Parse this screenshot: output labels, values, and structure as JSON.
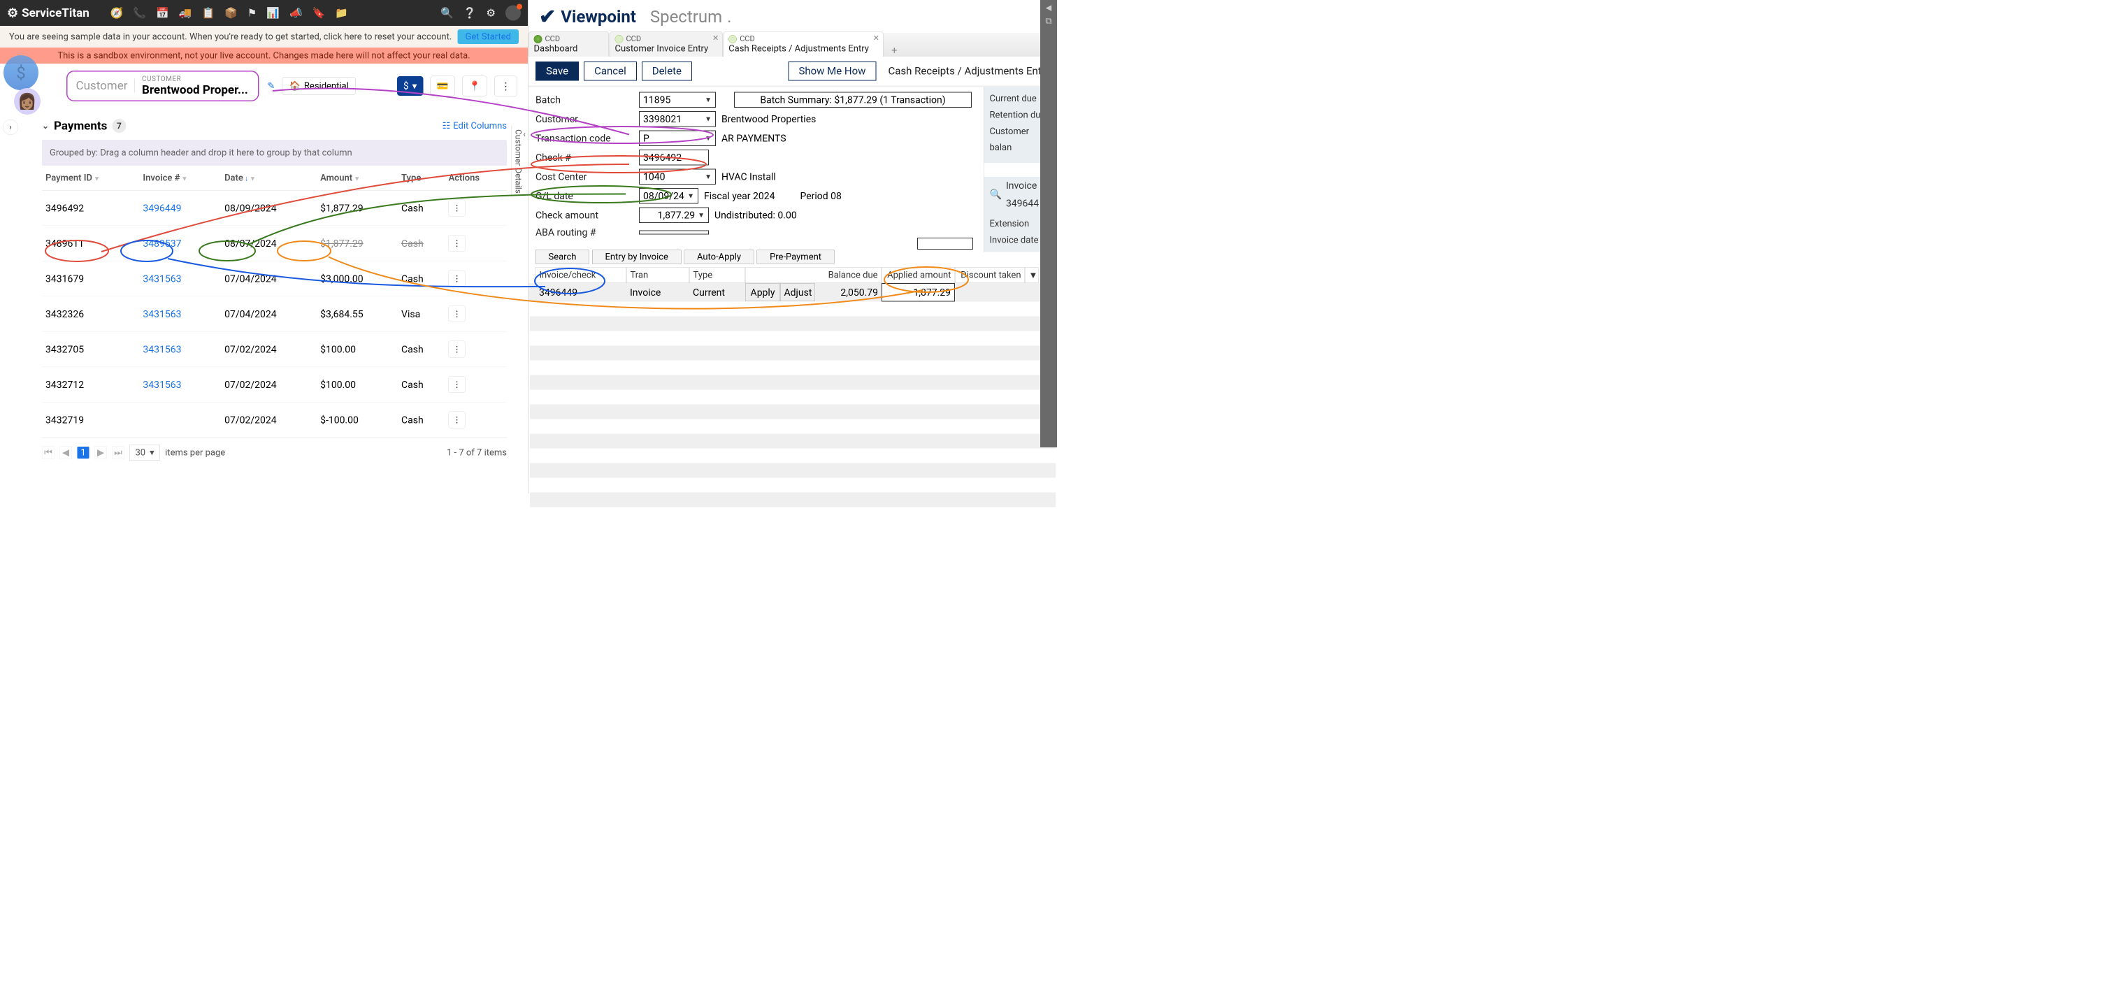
{
  "left": {
    "brand": "ServiceTitan",
    "banner1": "You are seeing sample data in your account. When you're ready to get started, click here to reset your account.",
    "get_started": "Get Started",
    "banner2": "This is a sandbox environment, not your live account. Changes made here will not affect your real data.",
    "customer_label_side": "Customer",
    "customer_smalllabel": "CUSTOMER",
    "customer_name": "Brentwood Proper...",
    "residential": "Residential",
    "side_tab": "Customer Details",
    "payments": {
      "title": "Payments",
      "count": "7",
      "edit_columns": "Edit Columns",
      "group_hint": "Grouped by:   Drag a column header and drop it here to group by that column",
      "cols": {
        "payment_id": "Payment ID",
        "invoice": "Invoice #",
        "date": "Date",
        "amount": "Amount",
        "type": "Type",
        "actions": "Actions"
      },
      "rows": [
        {
          "payment_id": "3496492",
          "invoice": "3496449",
          "date": "08/09/2024",
          "amount": "$1,877.29",
          "type": "Cash"
        },
        {
          "payment_id": "3489611",
          "invoice": "3489537",
          "date": "08/07/2024",
          "amount": "$1,877.29",
          "type": "Cash"
        },
        {
          "payment_id": "3431679",
          "invoice": "3431563",
          "date": "07/04/2024",
          "amount": "$3,000.00",
          "type": "Cash"
        },
        {
          "payment_id": "3432326",
          "invoice": "3431563",
          "date": "07/04/2024",
          "amount": "$3,684.55",
          "type": "Visa"
        },
        {
          "payment_id": "3432705",
          "invoice": "3431563",
          "date": "07/02/2024",
          "amount": "$100.00",
          "type": "Cash"
        },
        {
          "payment_id": "3432712",
          "invoice": "3431563",
          "date": "07/02/2024",
          "amount": "$100.00",
          "type": "Cash"
        },
        {
          "payment_id": "3432719",
          "invoice": "",
          "date": "07/02/2024",
          "amount": "$-100.00",
          "type": "Cash"
        }
      ],
      "pager": {
        "page": "1",
        "per_page": "30",
        "per_page_label": "items per page",
        "summary": "1 - 7 of 7 items"
      }
    }
  },
  "right": {
    "brand_vp": "Viewpoint",
    "brand_sp": "Spectrum",
    "tabs": [
      {
        "small": "CCD",
        "big": "Dashboard",
        "close": false,
        "dot": "green"
      },
      {
        "small": "CCD",
        "big": "Customer Invoice Entry",
        "close": true,
        "dot": "doc"
      },
      {
        "small": "CCD",
        "big": "Cash Receipts / Adjustments Entry",
        "close": true,
        "dot": "doc",
        "active": true
      }
    ],
    "save": "Save",
    "cancel": "Cancel",
    "delete": "Delete",
    "show_me": "Show Me How",
    "page_title": "Cash Receipts / Adjustments Entry",
    "form": {
      "batch_label": "Batch",
      "batch": "11895",
      "batch_summary": "Batch Summary: $1,877.29 (1 Transaction)",
      "customer_label": "Customer",
      "customer": "3398021",
      "customer_name": "Brentwood Properties",
      "tcode_label": "Transaction code",
      "tcode": "P",
      "tcode_name": "AR PAYMENTS",
      "check_label": "Check #",
      "check": "3496492",
      "cc_label": "Cost Center",
      "cc": "1040",
      "cc_name": "HVAC Install",
      "gl_label": "G/L date",
      "gl": "08/09/24",
      "fiscal": "Fiscal year 2024",
      "period": "Period 08",
      "amt_label": "Check amount",
      "amt": "1,877.29",
      "undist": "Undistributed: 0.00",
      "aba_label": "ABA routing #",
      "aba": ""
    },
    "sidebar": {
      "l1": "Current due",
      "l2": "Retention due",
      "l3": "Customer balan"
    },
    "search": {
      "invoice": "Invoice 349644",
      "ext": "Extension",
      "invdate": "Invoice date"
    },
    "grid_btns": [
      "Search",
      "Entry by Invoice",
      "Auto-Apply",
      "Pre-Payment"
    ],
    "grid_head": {
      "c1": "Invoice/check",
      "c2": "Tran",
      "c3": "Type",
      "c4": "Balance due",
      "c5": "Applied amount",
      "c6": "Discount taken"
    },
    "grid_row": {
      "inv": "3496449",
      "tran": "Invoice",
      "type": "Current",
      "apply": "Apply",
      "adjust": "Adjust",
      "bal": "2,050.79",
      "applied": "1,877.29"
    }
  }
}
